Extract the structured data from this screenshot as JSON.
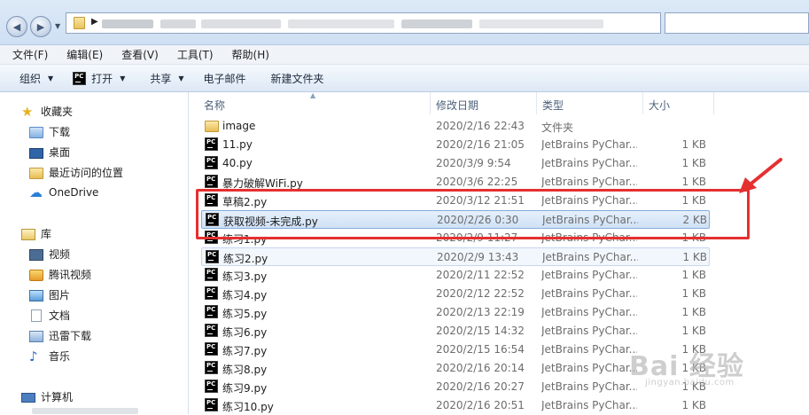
{
  "menu": [
    "文件(F)",
    "编辑(E)",
    "查看(V)",
    "工具(T)",
    "帮助(H)"
  ],
  "toolbar": {
    "organize": "组织",
    "open": "打开",
    "share": "共享",
    "email": "电子邮件",
    "new_folder": "新建文件夹"
  },
  "nav": {
    "favorites": "收藏夹",
    "downloads": "下载",
    "desktop": "桌面",
    "recent": "最近访问的位置",
    "onedrive": "OneDrive",
    "libraries": "库",
    "videos": "视频",
    "tencent_video": "腾讯视频",
    "pictures": "图片",
    "documents": "文档",
    "thunder": "迅雷下载",
    "music": "音乐",
    "computer": "计算机"
  },
  "columns": {
    "name": "名称",
    "date": "修改日期",
    "type": "类型",
    "size": "大小"
  },
  "files": [
    {
      "name": "image",
      "date": "2020/2/16 22:43",
      "type": "文件夹",
      "size": "",
      "icon": "folder-icon"
    },
    {
      "name": "11.py",
      "date": "2020/2/16 21:05",
      "type": "JetBrains PyChar...",
      "size": "1 KB",
      "icon": "pycharm-icon"
    },
    {
      "name": "40.py",
      "date": "2020/3/9 9:54",
      "type": "JetBrains PyChar...",
      "size": "1 KB",
      "icon": "pycharm-icon"
    },
    {
      "name": "暴力破解WiFi.py",
      "date": "2020/3/6 22:25",
      "type": "JetBrains PyChar...",
      "size": "1 KB",
      "icon": "pycharm-icon"
    },
    {
      "name": "草稿2.py",
      "date": "2020/3/12 21:51",
      "type": "JetBrains PyChar...",
      "size": "1 KB",
      "icon": "pycharm-icon"
    },
    {
      "name": "获取视频-未完成.py",
      "date": "2020/2/26 0:30",
      "type": "JetBrains PyChar...",
      "size": "2 KB",
      "icon": "pycharm-icon"
    },
    {
      "name": "练习1.py",
      "date": "2020/2/9 11:27",
      "type": "JetBrains PyChar...",
      "size": "1 KB",
      "icon": "pycharm-icon"
    },
    {
      "name": "练习2.py",
      "date": "2020/2/9 13:43",
      "type": "JetBrains PyChar...",
      "size": "1 KB",
      "icon": "pycharm-icon"
    },
    {
      "name": "练习3.py",
      "date": "2020/2/11 22:52",
      "type": "JetBrains PyChar...",
      "size": "1 KB",
      "icon": "pycharm-icon"
    },
    {
      "name": "练习4.py",
      "date": "2020/2/12 22:52",
      "type": "JetBrains PyChar...",
      "size": "1 KB",
      "icon": "pycharm-icon"
    },
    {
      "name": "练习5.py",
      "date": "2020/2/13 22:19",
      "type": "JetBrains PyChar...",
      "size": "1 KB",
      "icon": "pycharm-icon"
    },
    {
      "name": "练习6.py",
      "date": "2020/2/15 14:32",
      "type": "JetBrains PyChar...",
      "size": "1 KB",
      "icon": "pycharm-icon"
    },
    {
      "name": "练习7.py",
      "date": "2020/2/15 16:54",
      "type": "JetBrains PyChar...",
      "size": "1 KB",
      "icon": "pycharm-icon"
    },
    {
      "name": "练习8.py",
      "date": "2020/2/16 20:14",
      "type": "JetBrains PyChar...",
      "size": "1 KB",
      "icon": "pycharm-icon"
    },
    {
      "name": "练习9.py",
      "date": "2020/2/16 20:27",
      "type": "JetBrains PyChar...",
      "size": "1 KB",
      "icon": "pycharm-icon"
    },
    {
      "name": "练习10.py",
      "date": "2020/2/16 20:51",
      "type": "JetBrains PyChar...",
      "size": "1 KB",
      "icon": "pycharm-icon"
    }
  ],
  "watermark": {
    "main": "Bai 经验",
    "sub": "jingyan.baidu.com"
  },
  "colors": {
    "annotation": "#e53030",
    "selection": "#cfe1f6",
    "selection_border": "#84acdd"
  }
}
